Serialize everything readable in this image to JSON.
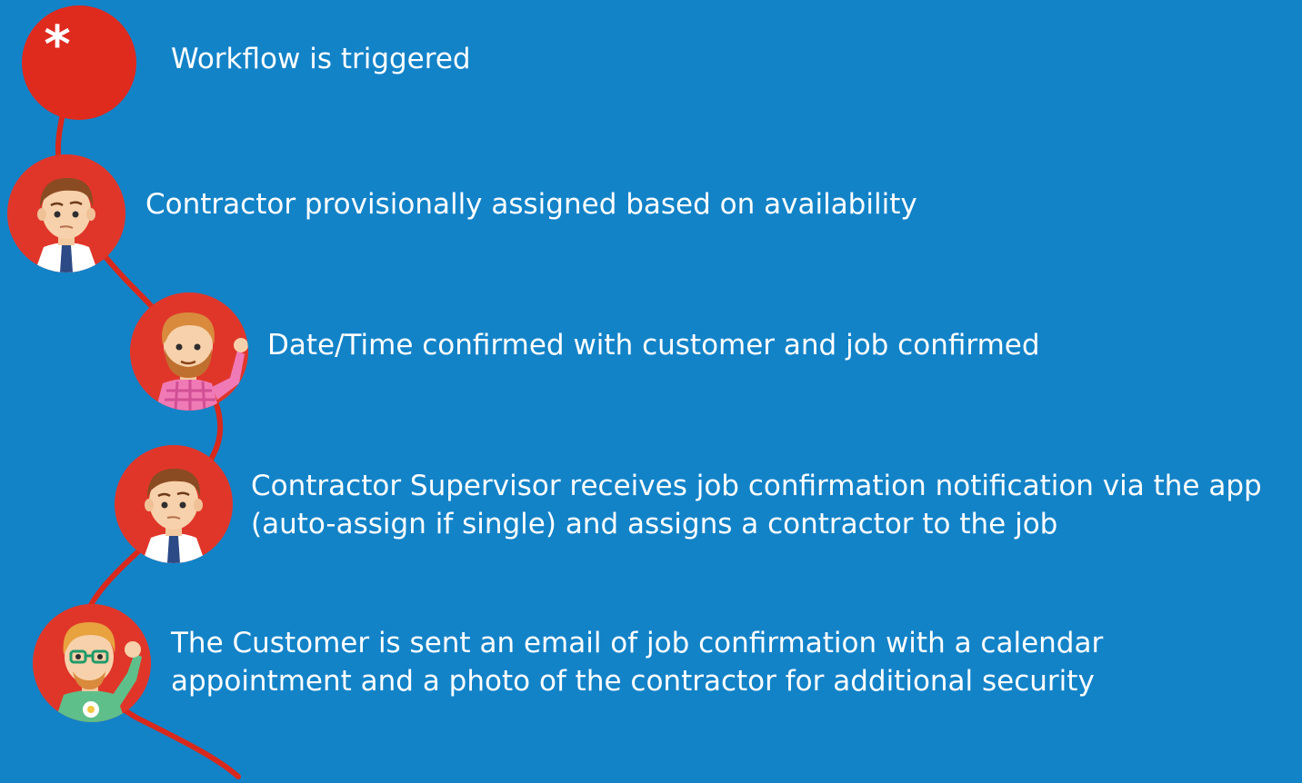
{
  "colors": {
    "background": "#1383c8",
    "node": "#e0362a",
    "connector": "#d8291c",
    "text": "#ffffff"
  },
  "trigger": {
    "symbol": "*",
    "icon": "asterisk-icon"
  },
  "steps": [
    {
      "text": "Workflow is triggered"
    },
    {
      "text": "Contractor provisionally assigned based on availability",
      "avatar": "businessman-avatar"
    },
    {
      "text": "Date/Time confirmed with customer and job confirmed",
      "avatar": "bearded-man-waving-avatar"
    },
    {
      "text": "Contractor Supervisor receives job confirmation notification via the app",
      "text_line2": "(auto-assign if single) and assigns a contractor to the job",
      "avatar": "businessman-avatar"
    },
    {
      "text": "The Customer is sent an email of job confirmation with a calendar",
      "text_line2": "appointment and a photo of the contractor for additional security",
      "avatar": "glasses-man-waving-avatar"
    }
  ]
}
